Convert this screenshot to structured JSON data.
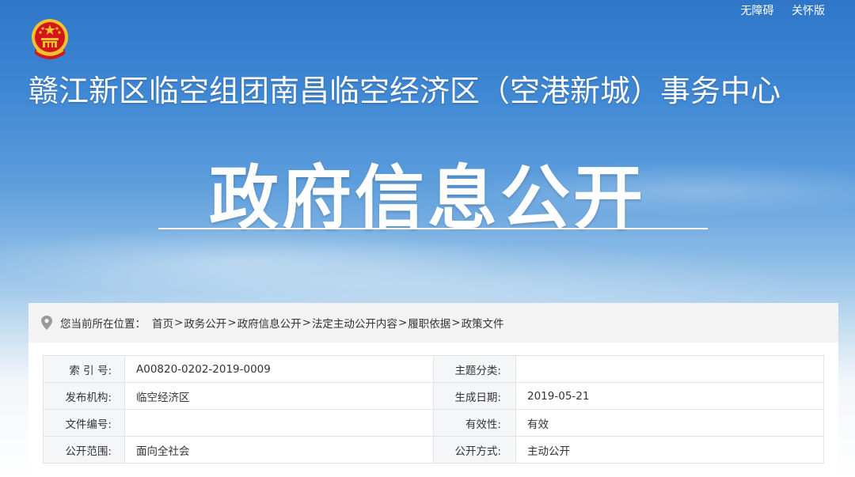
{
  "top_links": [
    "无障碍",
    "关怀版"
  ],
  "org_title": "赣江新区临空组团南昌临空经济区（空港新城）事务中心",
  "banner_title": "政府信息公开",
  "breadcrumb": {
    "prefix": "您当前所在位置：",
    "items": [
      "首页",
      "政务公开",
      "政府信息公开",
      "法定主动公开内容",
      "履职依据",
      "政策文件"
    ],
    "separator": ">"
  },
  "meta_rows": [
    {
      "left_label": "索 引 号:",
      "left_value": "A00820-0202-2019-0009",
      "right_label": "主题分类:",
      "right_value": ""
    },
    {
      "left_label": "发布机构:",
      "left_value": "临空经济区",
      "right_label": "生成日期:",
      "right_value": "2019-05-21"
    },
    {
      "left_label": "文件编号:",
      "left_value": "",
      "right_label": "有效性:",
      "right_value": "有效"
    },
    {
      "left_label": "公开范围:",
      "left_value": "面向全社会",
      "right_label": "公开方式:",
      "right_value": "主动公开"
    }
  ],
  "colors": {
    "sky_top": "#2f76c8",
    "label_bg": "#f5f6f8",
    "border": "#e3e3e3",
    "emblem_red": "#d3161b",
    "emblem_gold": "#f2c12e"
  }
}
